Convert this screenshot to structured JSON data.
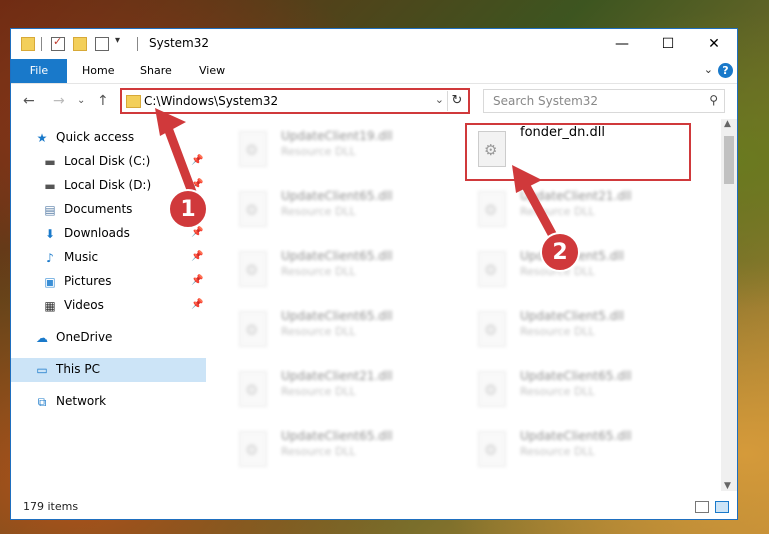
{
  "window": {
    "title": "System32"
  },
  "ribbon": {
    "file": "File",
    "home": "Home",
    "share": "Share",
    "view": "View"
  },
  "address": {
    "path": "C:\\Windows\\System32"
  },
  "search": {
    "placeholder": "Search System32"
  },
  "sidebar": {
    "items": [
      {
        "label": "Quick access",
        "icon": "star-icon"
      },
      {
        "label": "Local Disk (C:)",
        "icon": "drive-icon"
      },
      {
        "label": "Local Disk (D:)",
        "icon": "drive-icon"
      },
      {
        "label": "Documents",
        "icon": "documents-icon"
      },
      {
        "label": "Downloads",
        "icon": "download-icon"
      },
      {
        "label": "Music",
        "icon": "music-icon"
      },
      {
        "label": "Pictures",
        "icon": "pictures-icon"
      },
      {
        "label": "Videos",
        "icon": "videos-icon"
      },
      {
        "label": "OneDrive",
        "icon": "cloud-icon"
      },
      {
        "label": "This PC",
        "icon": "computer-icon"
      },
      {
        "label": "Network",
        "icon": "network-icon"
      }
    ]
  },
  "files": {
    "left": [
      {
        "name": "UpdateClient19.dll",
        "type": "Resource DLL"
      },
      {
        "name": "UpdateClient65.dll",
        "type": "Resource DLL"
      },
      {
        "name": "UpdateClient65.dll",
        "type": "Resource DLL"
      },
      {
        "name": "UpdateClient65.dll",
        "type": "Resource DLL"
      },
      {
        "name": "UpdateClient21.dll",
        "type": "Resource DLL"
      },
      {
        "name": "UpdateClient65.dll",
        "type": "Resource DLL"
      }
    ],
    "right": [
      {
        "name": "fonder_dn.dll",
        "type": ""
      },
      {
        "name": "UpdateClient21.dll",
        "type": "Resource DLL"
      },
      {
        "name": "UpdateClient5.dll",
        "type": "Resource DLL"
      },
      {
        "name": "UpdateClient5.dll",
        "type": "Resource DLL"
      },
      {
        "name": "UpdateClient65.dll",
        "type": "Resource DLL"
      },
      {
        "name": "UpdateClient65.dll",
        "type": "Resource DLL"
      }
    ]
  },
  "status": {
    "count": "179 items"
  },
  "annotations": {
    "badge1": "1",
    "badge2": "2"
  },
  "colors": {
    "accent": "#1979ca",
    "highlight": "#d0393b"
  }
}
